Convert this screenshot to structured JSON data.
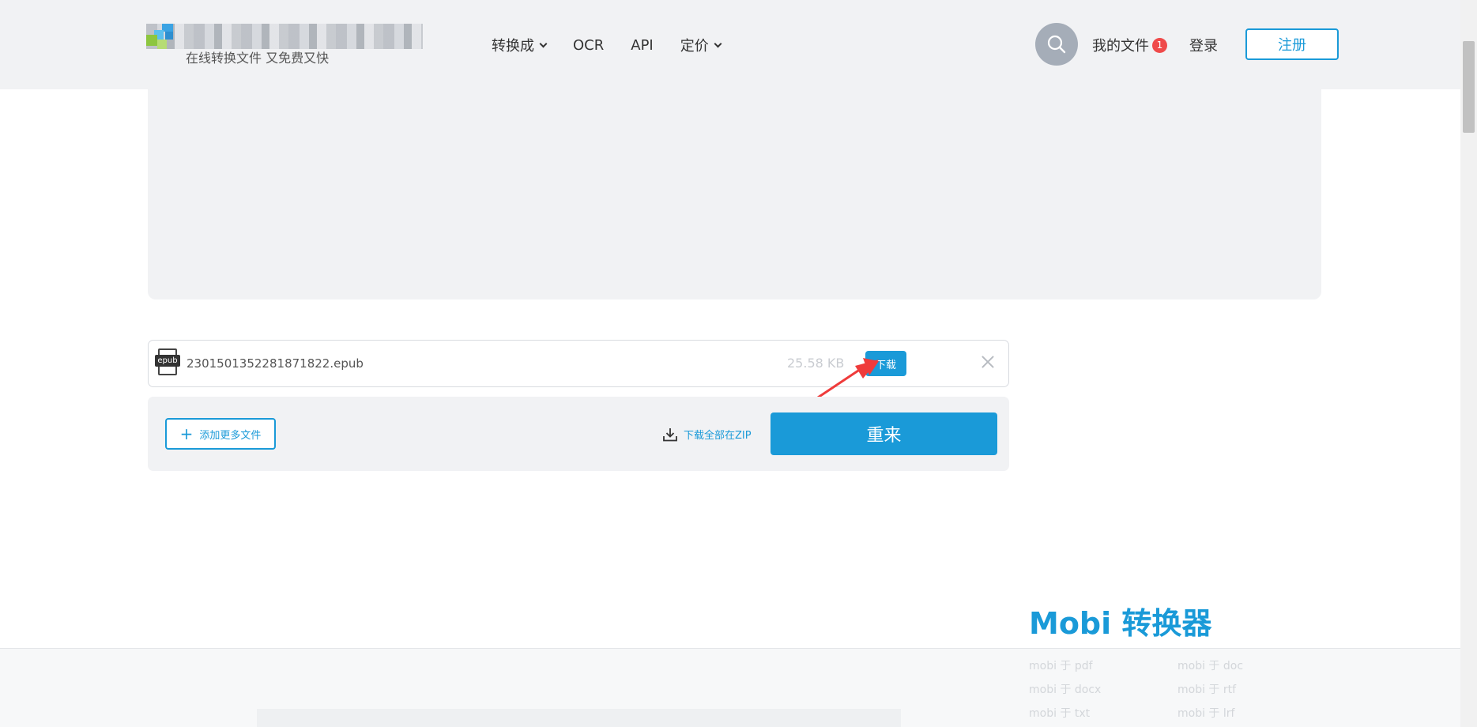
{
  "header": {
    "logo_tagline": "在线转换文件 又免费又快",
    "nav": [
      {
        "label": "转换成",
        "dropdown": true
      },
      {
        "label": "OCR",
        "dropdown": false
      },
      {
        "label": "API",
        "dropdown": false
      },
      {
        "label": "定价",
        "dropdown": true
      }
    ],
    "my_files_label": "我的文件",
    "my_files_count": "1",
    "login_label": "登录",
    "register_label": "注册"
  },
  "file": {
    "name": "2301501352281871822.epub",
    "type_tag": "epub",
    "size": "25.58 KB",
    "download_label": "下载"
  },
  "actions": {
    "add_more_label": "添加更多文件",
    "zip_label": "下载全部在ZIP",
    "restart_label": "重来"
  },
  "converter": {
    "title": "Mobi 转换器",
    "links": [
      "mobi 于 pdf",
      "mobi 于 doc",
      "mobi 于 docx",
      "mobi 于 rtf",
      "mobi 于 txt",
      "mobi 于 lrf"
    ]
  },
  "colors": {
    "accent": "#1a9ad8",
    "badge": "#ef4a4a",
    "annotation_arrow": "#ef3b3b",
    "header_bg": "#f1f2f4"
  }
}
